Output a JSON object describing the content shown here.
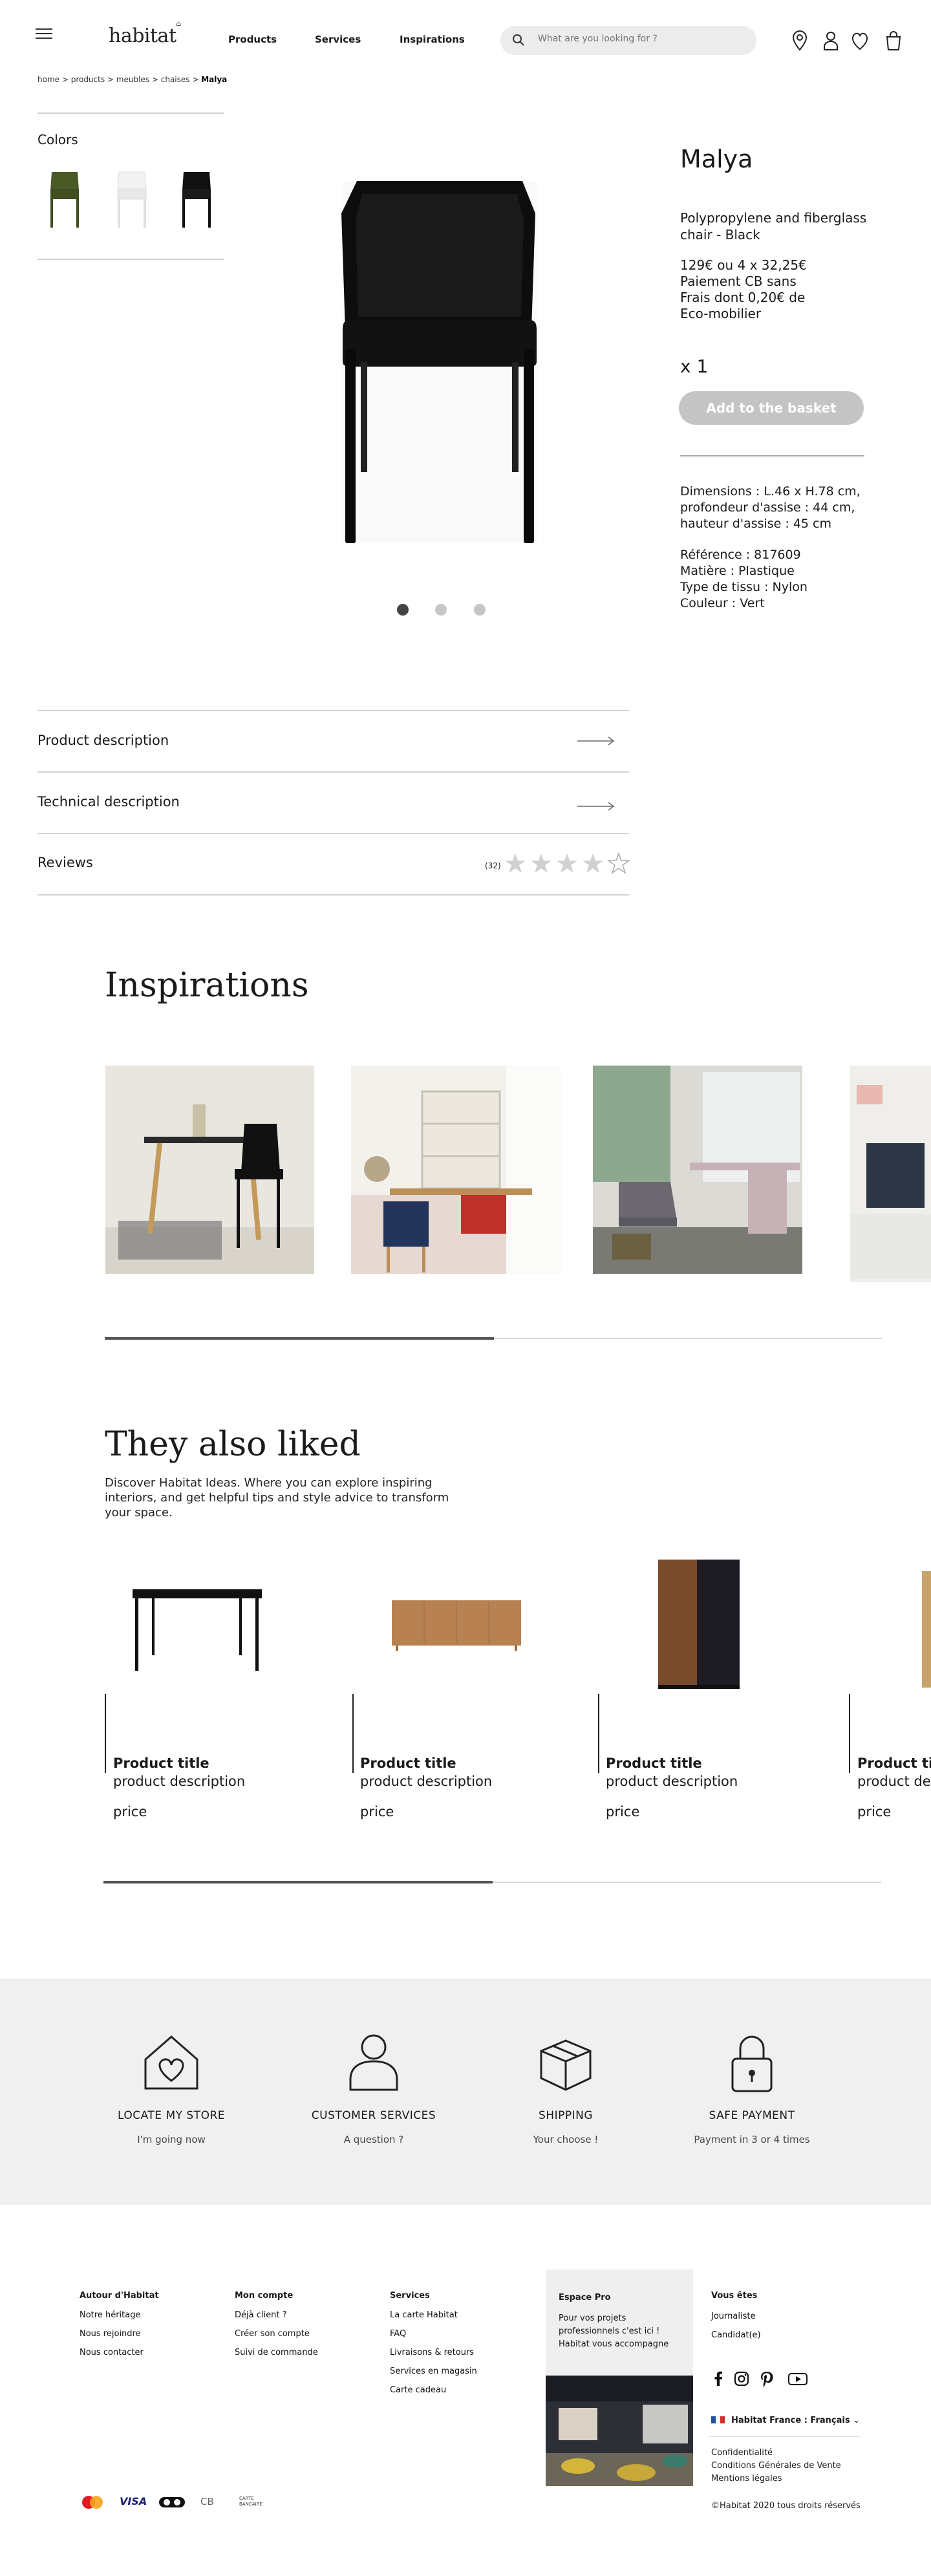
{
  "header": {
    "logo": "habitat",
    "nav": [
      "Products",
      "Services",
      "Inspirations"
    ],
    "search_placeholder": "What are you looking for ?"
  },
  "breadcrumb": {
    "trail": "home > products > meubles > chaises > ",
    "current": "Malya"
  },
  "colors": {
    "title": "Colors",
    "swatches": [
      "#4a5a27",
      "#f2f2f2",
      "#111111"
    ]
  },
  "product": {
    "name": "Malya",
    "subtitle": "Polypropylene and fiberglass chair - Black",
    "price_line1": "129€ ou 4 x 32,25€",
    "price_line2": "Paiement CB sans",
    "price_line3": "Frais dont 0,20€ de",
    "price_line4": "Eco-mobilier",
    "quantity": "x 1",
    "basket_label": "Add to the basket",
    "dimensions": "Dimensions : L.46 x H.78 cm, profondeur d'assise : 44 cm, hauteur d'assise : 45 cm",
    "reference": "Référence : 817609",
    "material": "Matière : Plastique",
    "fabric": "Type de tissu : Nylon",
    "color": "Couleur : Vert",
    "slides": 3,
    "active_slide": 1
  },
  "accordion": {
    "description": "Product description",
    "technical": "Technical description",
    "reviews": "Reviews",
    "reviews_count": "(32)",
    "rating": 0
  },
  "inspirations": {
    "title": "Inspirations",
    "progress": 0.5
  },
  "liked": {
    "title": "They also liked",
    "description": "Discover Habitat Ideas. Where you can explore inspiring interiors, and get helpful tips and style advice to transform your space.",
    "products": [
      {
        "title": "Product title",
        "desc": "product description",
        "price": "price"
      },
      {
        "title": "Product title",
        "desc": "product description",
        "price": "price"
      },
      {
        "title": "Product title",
        "desc": "product description",
        "price": "price"
      },
      {
        "title": "Product title",
        "desc": "product description",
        "price": "price"
      }
    ],
    "progress": 0.5
  },
  "services": [
    {
      "title": "LOCATE MY STORE",
      "sub": "I'm going now",
      "icon": "store-icon"
    },
    {
      "title": "CUSTOMER SERVICES",
      "sub": "A question ?",
      "icon": "customer-icon"
    },
    {
      "title": "SHIPPING",
      "sub": "Your choose !",
      "icon": "shipping-icon"
    },
    {
      "title": "SAFE PAYMENT",
      "sub": "Payment in 3 or 4 times",
      "icon": "lock-icon"
    }
  ],
  "footer": {
    "col1": {
      "title": "Autour d'Habitat",
      "links": [
        "Notre héritage",
        "Nous rejoindre",
        "Nous contacter"
      ]
    },
    "col2": {
      "title": "Mon compte",
      "links": [
        "Déjà client ?",
        "Créer son compte",
        "Suivi de commande"
      ]
    },
    "col3": {
      "title": "Services",
      "links": [
        "La carte Habitat",
        "FAQ",
        "Livraisons & retours",
        "Services en magasin",
        "Carte cadeau"
      ]
    },
    "espace": {
      "title": "Espace Pro",
      "text": "Pour vos projets professionnels c'est ici ! Habitat vous accompagne"
    },
    "col5": {
      "title": "Vous êtes",
      "links": [
        "Journaliste",
        "Candidat(e)"
      ]
    },
    "language": "Habitat France : Français",
    "legal": [
      "Confidentialité",
      "Conditions Générales de Vente",
      "Mentions légales"
    ],
    "copyright": "©Habitat 2020 tous droits réservés",
    "payments": [
      "mastercard",
      "VISA",
      "amex",
      "CB",
      "CARTE BANCAIRE"
    ]
  }
}
